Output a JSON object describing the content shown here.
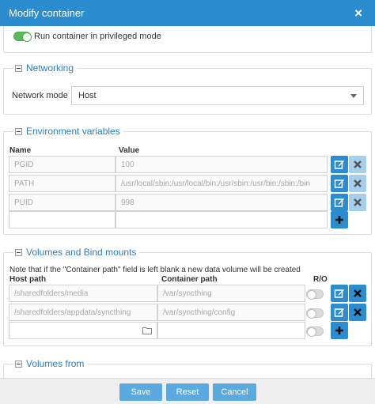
{
  "dialog": {
    "title": "Modify container",
    "close_glyph": "×"
  },
  "privileged": {
    "label": "Run container in privileged mode",
    "enabled": true
  },
  "networking": {
    "legend": "Networking",
    "network_mode_label": "Network mode",
    "network_mode_value": "Host"
  },
  "env": {
    "legend": "Environment variables",
    "headers": {
      "name": "Name",
      "value": "Value"
    },
    "rows": [
      {
        "name": "PGID",
        "value": "100"
      },
      {
        "name": "PATH",
        "value": "/usr/local/sbin:/usr/local/bin:/usr/sbin:/usr/bin:/sbin:/bin"
      },
      {
        "name": "PUID",
        "value": "998"
      }
    ]
  },
  "volumes": {
    "legend": "Volumes and Bind mounts",
    "note": "Note that if the \"Container path\" field is left blank a new data volume will be created",
    "headers": {
      "host": "Host path",
      "container": "Container path",
      "ro": "R/O"
    },
    "rows": [
      {
        "host": "/sharedfolders/media",
        "container": "/var/syncthing",
        "read_only": false
      },
      {
        "host": "/sharedfolders/appdata/syncthing",
        "container": "/var/syncthing/config",
        "read_only": false
      }
    ]
  },
  "volumes_from": {
    "legend": "Volumes from"
  },
  "footer": {
    "save": "Save",
    "reset": "Reset",
    "cancel": "Cancel"
  },
  "colors": {
    "accent": "#2b8ccf",
    "legend": "#2b7ec1",
    "toggle_on": "#5cb85c",
    "footer_btn": "#5aaae0"
  },
  "icons": {
    "edit": "pencil-square-icon",
    "delete": "x-icon",
    "add": "plus-icon",
    "folder": "folder-icon",
    "collapse": "minus-box-icon"
  }
}
